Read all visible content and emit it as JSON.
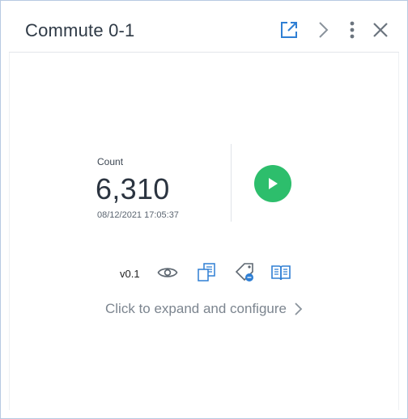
{
  "widget": {
    "title": "Commute 0-1"
  },
  "header": {
    "icons": [
      "external-link-icon",
      "chevron-right-icon",
      "more-vertical-icon",
      "close-icon"
    ]
  },
  "metric": {
    "label": "Count",
    "value": "6,310",
    "timestamp": "08/12/2021 17:05:37"
  },
  "toolbar": {
    "version": "v0.1",
    "icons": [
      "eye-icon",
      "copy-icon",
      "tag-icon",
      "book-icon"
    ]
  },
  "footer": {
    "expand_text": "Click to expand and configure"
  },
  "colors": {
    "accent_blue": "#2f7fd4",
    "play_green": "#2dbe6c",
    "title_text": "#2f3a46",
    "muted_text": "#7c858f"
  }
}
